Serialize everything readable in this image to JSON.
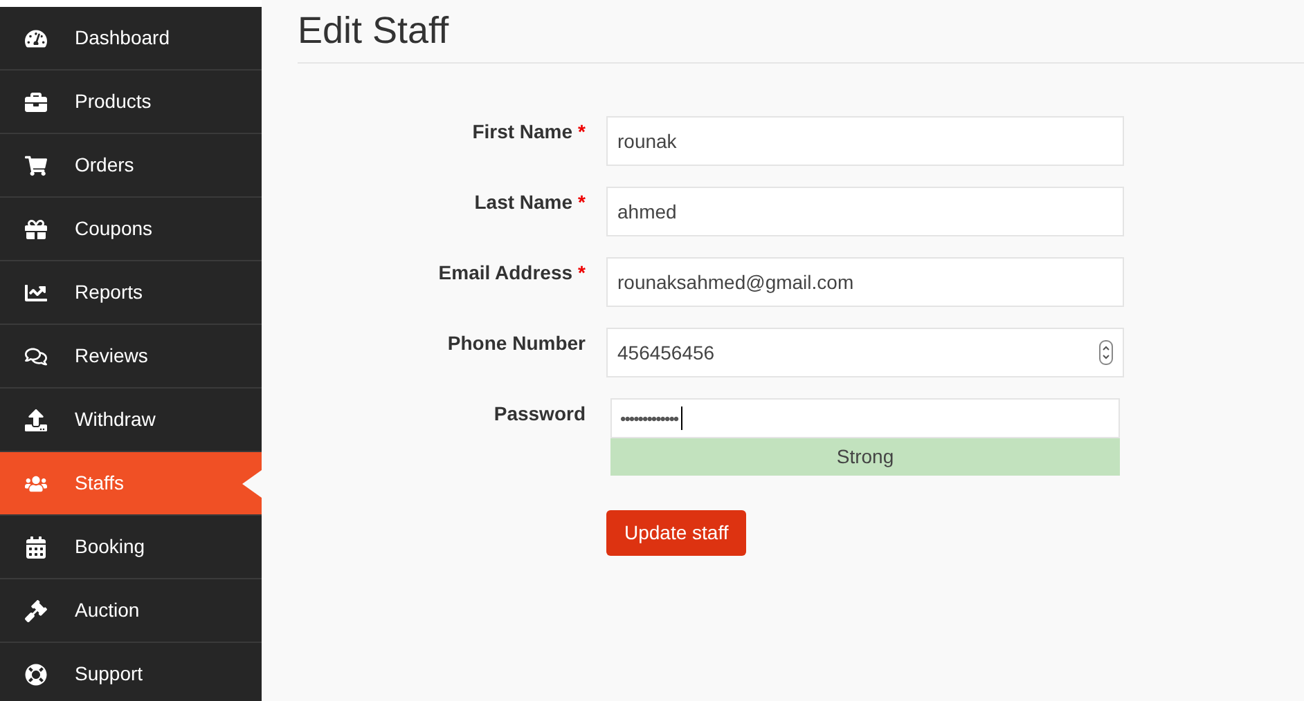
{
  "sidebar": {
    "items": [
      {
        "label": "Dashboard",
        "selected": false
      },
      {
        "label": "Products",
        "selected": false
      },
      {
        "label": "Orders",
        "selected": false
      },
      {
        "label": "Coupons",
        "selected": false
      },
      {
        "label": "Reports",
        "selected": false
      },
      {
        "label": "Reviews",
        "selected": false
      },
      {
        "label": "Withdraw",
        "selected": false
      },
      {
        "label": "Staffs",
        "selected": true
      },
      {
        "label": "Booking",
        "selected": false
      },
      {
        "label": "Auction",
        "selected": false
      },
      {
        "label": "Support",
        "selected": false
      }
    ]
  },
  "page": {
    "title": "Edit Staff"
  },
  "form": {
    "fields": [
      {
        "kind": "text",
        "label": "First Name",
        "required": true,
        "value": "rounak"
      },
      {
        "kind": "text",
        "label": "Last Name",
        "required": true,
        "value": "ahmed"
      },
      {
        "kind": "text",
        "label": "Email Address",
        "required": true,
        "value": "rounaksahmed@gmail.com"
      },
      {
        "kind": "number",
        "label": "Phone Number",
        "required": false,
        "value": "456456456"
      },
      {
        "kind": "password",
        "label": "Password",
        "required": false,
        "value": "•••••••••••••",
        "strength": "Strong"
      }
    ],
    "required_mark": "*",
    "submit": "Update staff"
  }
}
